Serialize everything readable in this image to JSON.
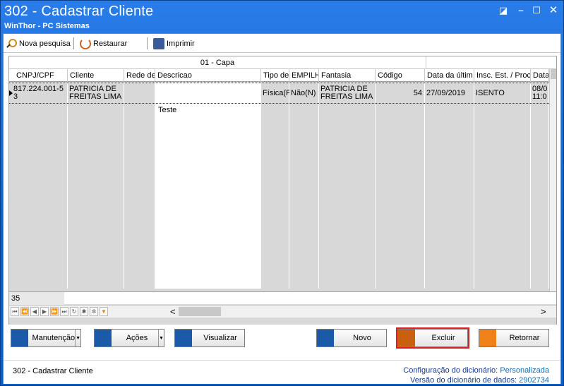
{
  "window": {
    "title": "302 - Cadastrar Cliente",
    "subtitle": "WinThor - PC Sistemas",
    "controls": {
      "restore": "◪",
      "minimize": "–",
      "maximize": "☐",
      "close": "✕"
    }
  },
  "toolbar": {
    "search_label": "Nova pesquisa",
    "restore_label": "Restaurar",
    "print_label": "Imprimir"
  },
  "grid": {
    "group_header": "01 - Capa",
    "columns": [
      "CNPJ/CPF",
      "Cliente",
      "Rede de",
      "Descricao",
      "Tipo de",
      "EMPILH",
      "Fantasia",
      "Código",
      "Data da últim",
      "Insc. Est. / Proc",
      "Data"
    ],
    "row": {
      "cnpj": "817.224.001-5\n3",
      "cliente": "PATRICIA DE\nFREITAS LIMA",
      "rede": "",
      "descricao": "",
      "tipo": "Física(F",
      "empilh": "Não(N)",
      "fantasia": "PATRICIA DE\nFREITAS LIMA",
      "codigo": "54",
      "data_ultima": "27/09/2019",
      "insc": "ISENTO",
      "data": "08/0\n11:0"
    },
    "descricao_extra": "Teste",
    "footer_count": "35"
  },
  "navbar": {
    "left_arrow": "<",
    "right_arrow": ">"
  },
  "buttons": {
    "manutencao": "Manutenção",
    "acoes": "Ações",
    "visualizar": "Visualizar",
    "novo": "Novo",
    "excluir": "Excluir",
    "retornar": "Retornar"
  },
  "status": {
    "left": "302 - Cadastrar Cliente",
    "config_label": "Configuração do dicionário:",
    "config_value": "Personalizada",
    "version_label": "Versão do dicionário de dados:",
    "version_value": "2902734"
  }
}
